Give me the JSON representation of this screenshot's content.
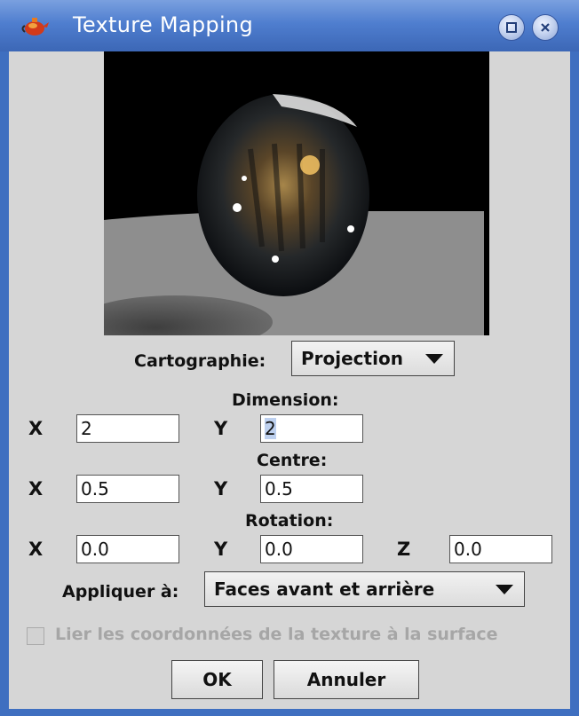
{
  "window": {
    "title": "Texture Mapping"
  },
  "form": {
    "mapping_label": "Cartographie:",
    "mapping_value": "Projection",
    "dimension_label": "Dimension:",
    "centre_label": "Centre:",
    "rotation_label": "Rotation:",
    "x_label": "X",
    "y_label": "Y",
    "z_label": "Z",
    "dimension": {
      "x": "2",
      "y": "2"
    },
    "centre": {
      "x": "0.5",
      "y": "0.5"
    },
    "rotation": {
      "x": "0.0",
      "y": "0.0",
      "z": "0.0"
    },
    "apply_label": "Appliquer à:",
    "apply_value": "Faces avant et arrière",
    "link_checkbox_label": "Lier les coordonnées de la texture à la surface",
    "link_checkbox_checked": false
  },
  "buttons": {
    "ok": "OK",
    "cancel": "Annuler"
  },
  "icons": {
    "app": "teapot-icon",
    "maximize": "maximize-icon",
    "close": "close-icon",
    "dropdown": "chevron-down-icon"
  }
}
